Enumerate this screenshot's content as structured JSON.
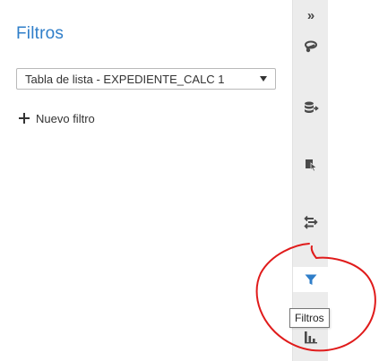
{
  "panel": {
    "title": "Filtros",
    "data_source_select": {
      "value": "Tabla de lista - EXPEDIENTE_CALC 1"
    },
    "add_filter_label": "Nuevo filtro"
  },
  "toolbar": {
    "collapse_glyph": "»",
    "items": [
      {
        "icon": "brush-icon",
        "active": false
      },
      {
        "icon": "database-export-icon",
        "active": false
      },
      {
        "icon": "select-pointer-icon",
        "active": false
      },
      {
        "icon": "swap-options-icon",
        "active": false
      },
      {
        "icon": "filter-funnel-icon",
        "active": true
      },
      {
        "icon": "bar-chart-icon",
        "active": false
      }
    ],
    "tooltip": "Filtros"
  },
  "colors": {
    "accent": "#2f7ec9",
    "icon": "#4a4a4a",
    "annotation": "#e01b1b"
  }
}
